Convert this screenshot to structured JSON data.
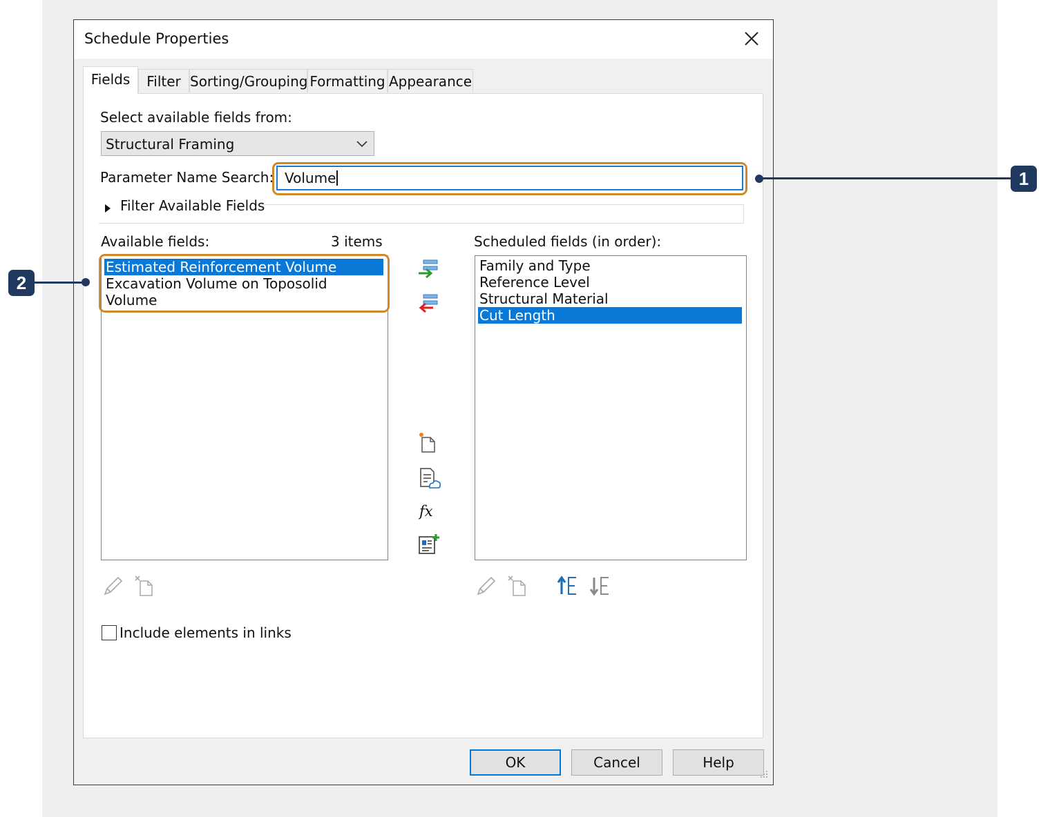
{
  "dialog": {
    "title": "Schedule Properties",
    "close_icon": "close-icon"
  },
  "tabs": [
    {
      "label": "Fields",
      "active": true
    },
    {
      "label": "Filter",
      "active": false
    },
    {
      "label": "Sorting/Grouping",
      "active": false
    },
    {
      "label": "Formatting",
      "active": false
    },
    {
      "label": "Appearance",
      "active": false
    }
  ],
  "fields_tab": {
    "select_from_label": "Select available fields from:",
    "select_from_value": "Structural Framing",
    "search_label": "Parameter Name Search:",
    "search_value": "Volume",
    "filter_expander_label": "Filter Available Fields",
    "available_label": "Available fields:",
    "available_count": "3 items",
    "available_fields": [
      {
        "label": "Estimated Reinforcement Volume",
        "selected": true
      },
      {
        "label": "Excavation Volume on Toposolid",
        "selected": false
      },
      {
        "label": "Volume",
        "selected": false
      }
    ],
    "scheduled_label": "Scheduled fields (in order):",
    "scheduled_fields": [
      {
        "label": "Family and Type",
        "selected": false
      },
      {
        "label": "Reference Level",
        "selected": false
      },
      {
        "label": "Structural Material",
        "selected": false
      },
      {
        "label": "Cut Length",
        "selected": true
      }
    ],
    "include_links_label": "Include elements in links",
    "include_links_checked": false
  },
  "buttons": {
    "ok": "OK",
    "cancel": "Cancel",
    "help": "Help"
  },
  "callouts": {
    "one": "1",
    "two": "2"
  },
  "colors": {
    "selection": "#0a78d7",
    "highlight": "#d0882b",
    "callout": "#1f3a5e",
    "add_arrow": "#2e9b2e",
    "remove_arrow": "#e02020",
    "move_up_arrow": "#1f6fb8"
  }
}
